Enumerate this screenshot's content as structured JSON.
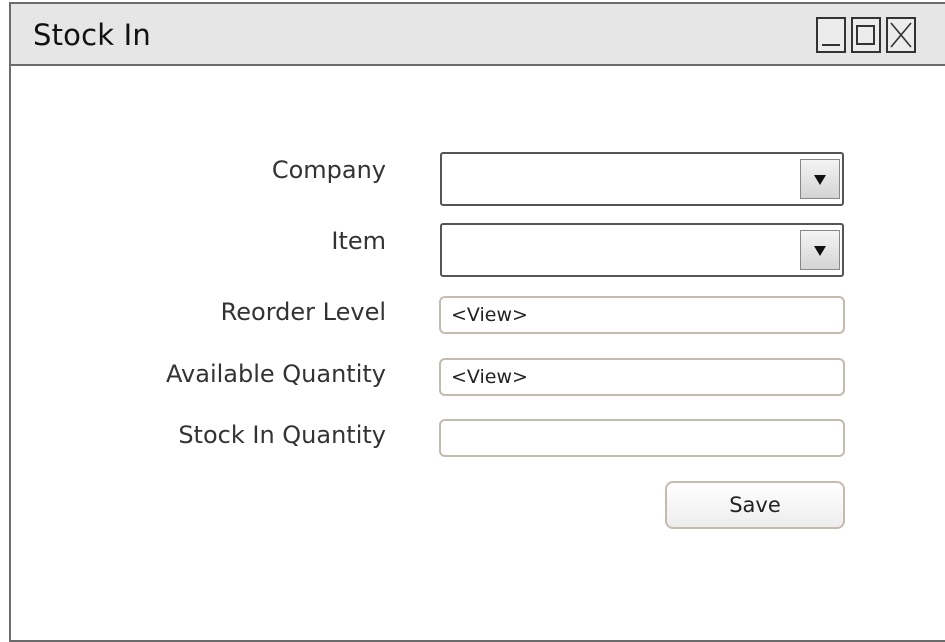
{
  "window": {
    "title": "Stock In"
  },
  "form": {
    "company": {
      "label": "Company",
      "value": ""
    },
    "item": {
      "label": "Item",
      "value": ""
    },
    "reorder_level": {
      "label": "Reorder Level",
      "value": "<View>"
    },
    "available_quantity": {
      "label": "Available Quantity",
      "value": "<View>"
    },
    "stock_in_quantity": {
      "label": "Stock In Quantity",
      "value": ""
    },
    "save_label": "Save"
  },
  "icons": {
    "minimize": "minimize-icon",
    "maximize": "maximize-icon",
    "close": "close-icon",
    "dropdown": "triangle-down-icon"
  }
}
